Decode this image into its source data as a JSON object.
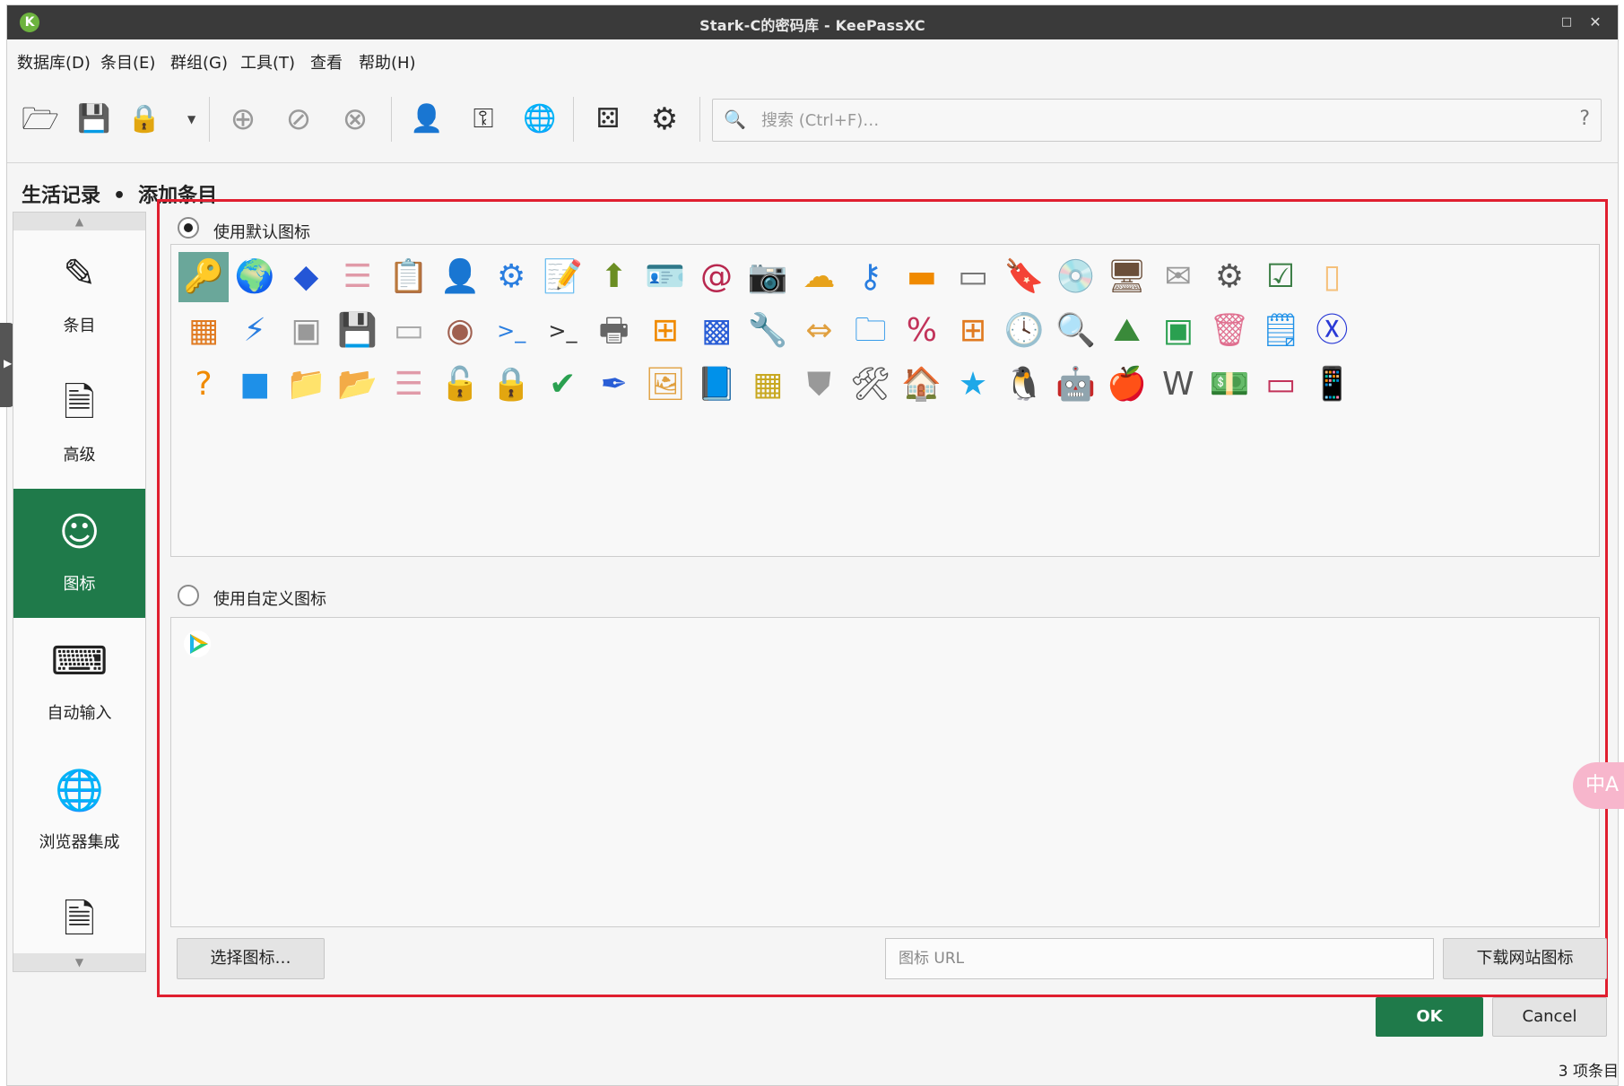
{
  "window": {
    "title": "Stark-C的密码库 - KeePassXC",
    "maximize_glyph": "□",
    "close_glyph": "✕"
  },
  "menu": [
    "数据库(D)",
    "条目(E)",
    "群组(G)",
    "工具(T)",
    "查看",
    "帮助(H)"
  ],
  "toolbar": {
    "search_placeholder": "搜索 (Ctrl+F)…",
    "help_glyph": "?"
  },
  "breadcrumb": {
    "group": "生活记录",
    "separator": "•",
    "action": "添加条目"
  },
  "categories": [
    {
      "label": "条目",
      "icon": "pencil-icon"
    },
    {
      "label": "高级",
      "icon": "document-edit-icon"
    },
    {
      "label": "图标",
      "icon": "smiley-icon",
      "active": true
    },
    {
      "label": "自动输入",
      "icon": "keyboard-icon"
    },
    {
      "label": "浏览器集成",
      "icon": "globe-icon"
    },
    {
      "label": "",
      "icon": "document-edit-icon"
    }
  ],
  "icons_section": {
    "default_label": "使用默认图标",
    "custom_label": "使用自定义图标",
    "default_selected": true,
    "selected_index": 0
  },
  "buttons": {
    "choose_icon": "选择图标…",
    "url_placeholder": "图标 URL",
    "download_favicon": "下载网站图标",
    "ok": "OK",
    "cancel": "Cancel"
  },
  "status_bar": "3 项条目",
  "translate_widget": "中A",
  "accent_color": "#1f7a4a",
  "highlight_color": "#e01f2f"
}
